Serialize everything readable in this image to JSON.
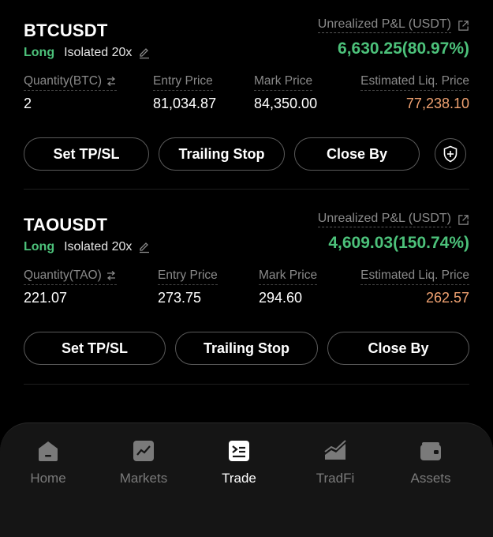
{
  "positions": [
    {
      "symbol": "BTCUSDT",
      "side": "Long",
      "mode": "Isolated 20x",
      "pnl_label": "Unrealized P&L (USDT)",
      "pnl_value": "6,630.25(80.97%)",
      "quantity_label": "Quantity(BTC)",
      "quantity": "2",
      "entry_label": "Entry Price",
      "entry": "81,034.87",
      "mark_label": "Mark Price",
      "mark": "84,350.00",
      "liq_label": "Estimated Liq. Price",
      "liq": "77,238.10",
      "buttons": {
        "tpsl": "Set TP/SL",
        "trailing": "Trailing Stop",
        "close": "Close By"
      }
    },
    {
      "symbol": "TAOUSDT",
      "side": "Long",
      "mode": "Isolated 20x",
      "pnl_label": "Unrealized P&L (USDT)",
      "pnl_value": "4,609.03(150.74%)",
      "quantity_label": "Quantity(TAO)",
      "quantity": "221.07",
      "entry_label": "Entry Price",
      "entry": "273.75",
      "mark_label": "Mark Price",
      "mark": "294.60",
      "liq_label": "Estimated Liq. Price",
      "liq": "262.57",
      "buttons": {
        "tpsl": "Set TP/SL",
        "trailing": "Trailing Stop",
        "close": "Close By"
      }
    }
  ],
  "tabbar": {
    "active": "Trade",
    "items": [
      {
        "label": "Home",
        "icon": "home-icon"
      },
      {
        "label": "Markets",
        "icon": "chart-icon"
      },
      {
        "label": "Trade",
        "icon": "trade-icon"
      },
      {
        "label": "TradFi",
        "icon": "tradfi-icon"
      },
      {
        "label": "Assets",
        "icon": "wallet-icon"
      }
    ]
  },
  "colors": {
    "profit": "#4cc17a",
    "liquidation": "#f0a271",
    "muted": "#8a8a8a",
    "background": "#000000"
  }
}
